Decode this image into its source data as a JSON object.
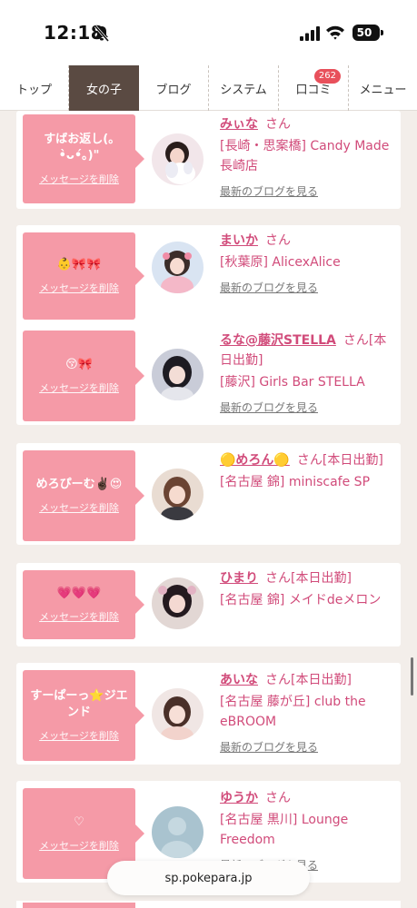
{
  "status_bar": {
    "time": "12:18",
    "battery": "50",
    "battery_level": 0.5
  },
  "nav": {
    "tabs": [
      {
        "label": "トップ"
      },
      {
        "label": "女の子"
      },
      {
        "label": "ブログ"
      },
      {
        "label": "システム"
      },
      {
        "label": "口コミ"
      },
      {
        "label": "メニュー"
      }
    ],
    "review_badge": "262"
  },
  "common": {
    "delete_label": "メッセージを削除",
    "honorific": "さん",
    "blog_link": "最新のブログを見る"
  },
  "cards": [
    {
      "message": "すばお返し(｡•̀ᴗ•́｡)\"",
      "name": "みぃな",
      "status": "",
      "shop": "[長崎・思案橋] Candy Made長崎店"
    },
    {
      "message": "👶🎀🎀",
      "name": "まいか",
      "status": "",
      "shop": "[秋葉原] AlicexAlice"
    },
    {
      "message": "😚🎀",
      "name": "るな@藤沢STELLA",
      "status": "[本日出勤]",
      "shop": "[藤沢] Girls Bar STELLA"
    },
    {
      "message": "めろぴーむ✌🏿😍",
      "name": "🟡めろん🟡",
      "status": "[本日出勤]",
      "shop": "[名古屋 錦] miniscafe SP"
    },
    {
      "message": "💗💗💗",
      "name": "ひまり",
      "status": "[本日出勤]",
      "shop": "[名古屋 錦] メイドdeメロン"
    },
    {
      "message": "すーぱーっ⭐ジエンド",
      "name": "あいな",
      "status": "[本日出勤]",
      "shop": "[名古屋 藤が丘] club the eBROOM"
    },
    {
      "message": "♡",
      "name": "ゆうか",
      "status": "",
      "shop": "[名古屋 黒川] Lounge Freedom"
    }
  ],
  "avatars": [
    "avatar-girl-with-plush",
    "avatar-girl-pink-outfit",
    "avatar-girl-dark-hair",
    "avatar-girl-brown-hair",
    "avatar-girl-twin-tails",
    "avatar-girl-portrait",
    "avatar-no-photo"
  ],
  "url_bar": {
    "domain": "sp.pokepara.jp"
  },
  "colors": {
    "accent_pink": "#f59aa7",
    "name_pink": "#d14b7a",
    "nav_active": "#5a4a42",
    "badge_red": "#e8505b"
  }
}
